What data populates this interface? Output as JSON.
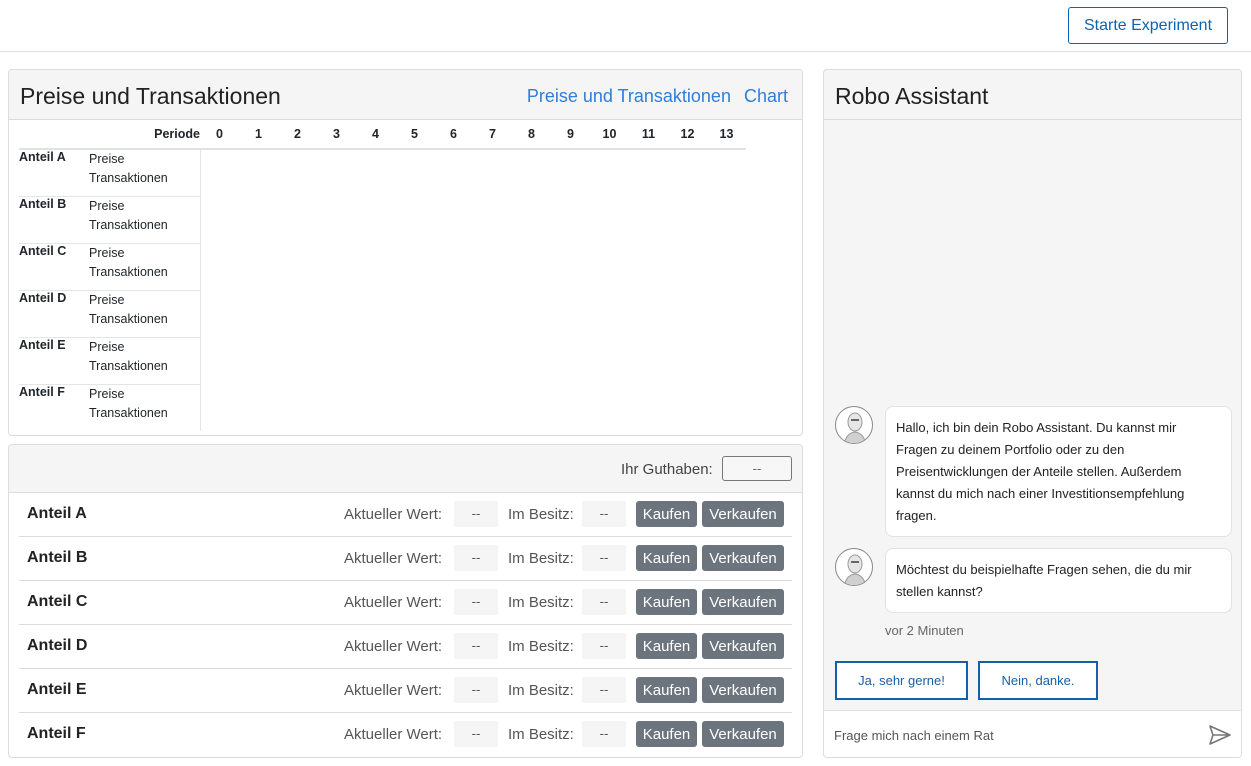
{
  "topbar": {
    "start_label": "Starte Experiment"
  },
  "prices": {
    "title": "Preise und Transaktionen",
    "links": [
      "Preise und Transaktionen",
      "Chart"
    ],
    "periode_label": "Periode",
    "periods": [
      "0",
      "1",
      "2",
      "3",
      "4",
      "5",
      "6",
      "7",
      "8",
      "9",
      "10",
      "11",
      "12",
      "13"
    ],
    "rows": [
      {
        "name": "Anteil A",
        "preise": "Preise",
        "transaktionen": "Transaktionen"
      },
      {
        "name": "Anteil B",
        "preise": "Preise",
        "transaktionen": "Transaktionen"
      },
      {
        "name": "Anteil C",
        "preise": "Preise",
        "transaktionen": "Transaktionen"
      },
      {
        "name": "Anteil D",
        "preise": "Preise",
        "transaktionen": "Transaktionen"
      },
      {
        "name": "Anteil E",
        "preise": "Preise",
        "transaktionen": "Transaktionen"
      },
      {
        "name": "Anteil F",
        "preise": "Preise",
        "transaktionen": "Transaktionen"
      }
    ]
  },
  "trade": {
    "guthaben_label": "Ihr Guthaben:",
    "guthaben_value": "--",
    "wert_label": "Aktueller Wert:",
    "besitz_label": "Im Besitz:",
    "kaufen_label": "Kaufen",
    "verkaufen_label": "Verkaufen",
    "rows": [
      {
        "name": "Anteil A",
        "wert": "--",
        "besitz": "--"
      },
      {
        "name": "Anteil B",
        "wert": "--",
        "besitz": "--"
      },
      {
        "name": "Anteil C",
        "wert": "--",
        "besitz": "--"
      },
      {
        "name": "Anteil D",
        "wert": "--",
        "besitz": "--"
      },
      {
        "name": "Anteil E",
        "wert": "--",
        "besitz": "--"
      },
      {
        "name": "Anteil F",
        "wert": "--",
        "besitz": "--"
      }
    ]
  },
  "robo": {
    "title": "Robo Assistant",
    "messages": [
      "Hallo, ich bin dein Robo Assistant. Du kannst mir Fragen zu deinem Portfolio oder zu den Preisentwicklungen der Anteile stellen. Außerdem kannst du mich nach einer Investitionsempfehlung fragen.",
      "Möchtest du beispielhafte Fragen sehen, die du mir stellen kannst?"
    ],
    "time": "vor 2 Minuten",
    "choice_yes": "Ja, sehr gerne!",
    "choice_no": "Nein, danke.",
    "input_placeholder": "Frage mich nach einem Rat"
  },
  "colors": {
    "accent": "#0d63b3",
    "link": "#2f7ed8",
    "button_grey": "#6c757d"
  }
}
